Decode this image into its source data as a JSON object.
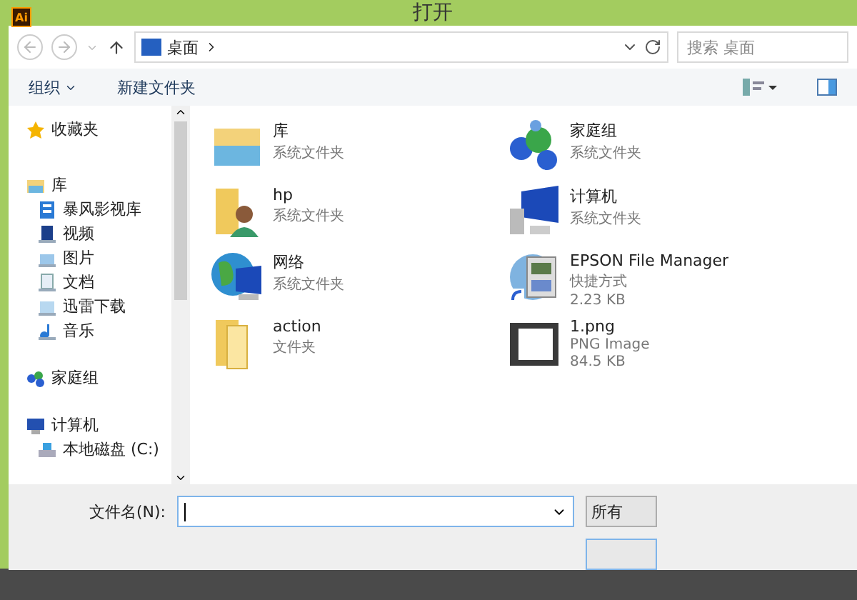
{
  "window": {
    "title": "打开",
    "app_badge": "Ai"
  },
  "address": {
    "location": "桌面",
    "search_placeholder": "搜索 桌面"
  },
  "toolbar": {
    "organize": "组织",
    "new_folder": "新建文件夹"
  },
  "sidebar": {
    "groups": [
      {
        "label": "收藏夹",
        "kind": "star"
      },
      {
        "label": "库",
        "kind": "library",
        "children": [
          {
            "label": "暴风影视库",
            "kind": "grid"
          },
          {
            "label": "视频",
            "kind": "video"
          },
          {
            "label": "图片",
            "kind": "image"
          },
          {
            "label": "文档",
            "kind": "doc"
          },
          {
            "label": "迅雷下载",
            "kind": "download"
          },
          {
            "label": "音乐",
            "kind": "music"
          }
        ]
      },
      {
        "label": "家庭组",
        "kind": "homegroup"
      },
      {
        "label": "计算机",
        "kind": "computer",
        "children": [
          {
            "label": "本地磁盘 (C:)",
            "kind": "disk"
          }
        ]
      }
    ]
  },
  "items": [
    {
      "name": "库",
      "kind": "library",
      "details": [
        "系统文件夹"
      ]
    },
    {
      "name": "家庭组",
      "kind": "homegroup",
      "details": [
        "系统文件夹"
      ]
    },
    {
      "name": "hp",
      "kind": "userfolder",
      "details": [
        "系统文件夹"
      ]
    },
    {
      "name": "计算机",
      "kind": "computer",
      "details": [
        "系统文件夹"
      ]
    },
    {
      "name": "网络",
      "kind": "network",
      "details": [
        "系统文件夹"
      ]
    },
    {
      "name": "EPSON File Manager",
      "kind": "shortcut",
      "details": [
        "快捷方式",
        "2.23 KB"
      ]
    },
    {
      "name": "action",
      "kind": "folder",
      "details": [
        "文件夹"
      ]
    },
    {
      "name": "1.png",
      "kind": "image",
      "details": [
        "PNG Image",
        "84.5 KB"
      ]
    }
  ],
  "footer": {
    "filename_label": "文件名(N):",
    "filetype": "所有"
  }
}
